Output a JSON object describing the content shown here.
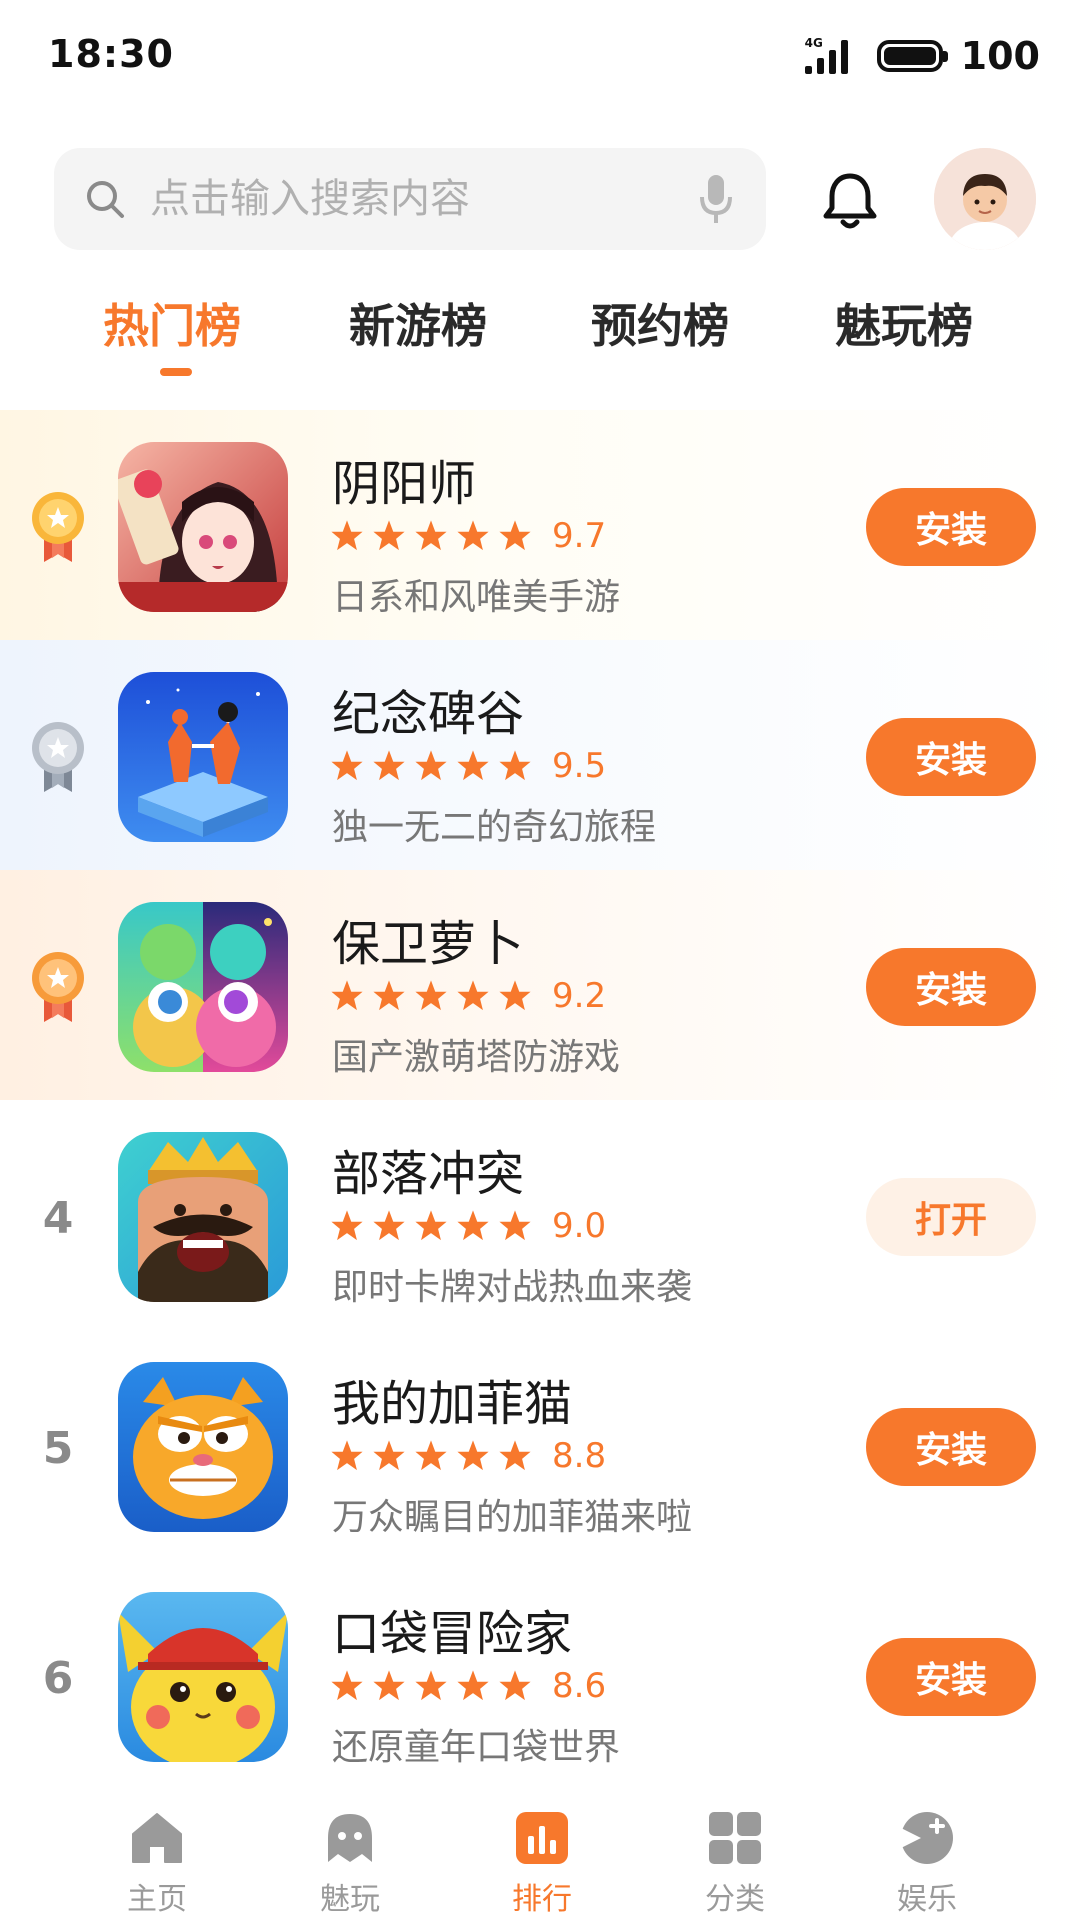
{
  "status_bar": {
    "time": "18:30",
    "network": "4G",
    "battery": "100"
  },
  "search": {
    "placeholder": "点击输入搜索内容"
  },
  "tabs": [
    {
      "label": "热门榜",
      "active": true
    },
    {
      "label": "新游榜",
      "active": false
    },
    {
      "label": "预约榜",
      "active": false
    },
    {
      "label": "魅玩榜",
      "active": false
    }
  ],
  "apps": [
    {
      "rank": "1",
      "title": "阴阳师",
      "rating": "9.7",
      "desc": "日系和风唯美手游",
      "button": "安装"
    },
    {
      "rank": "2",
      "title": "纪念碑谷",
      "rating": "9.5",
      "desc": "独一无二的奇幻旅程",
      "button": "安装"
    },
    {
      "rank": "3",
      "title": "保卫萝卜",
      "rating": "9.2",
      "desc": "国产激萌塔防游戏",
      "button": "安装"
    },
    {
      "rank": "4",
      "title": "部落冲突",
      "rating": "9.0",
      "desc": "即时卡牌对战热血来袭",
      "button": "打开"
    },
    {
      "rank": "5",
      "title": "我的加菲猫",
      "rating": "8.8",
      "desc": "万众瞩目的加菲猫来啦",
      "button": "安装"
    },
    {
      "rank": "6",
      "title": "口袋冒险家",
      "rating": "8.6",
      "desc": "还原童年口袋世界",
      "button": "安装"
    }
  ],
  "bottom_nav": [
    {
      "label": "主页",
      "icon": "home-icon",
      "active": false
    },
    {
      "label": "魅玩",
      "icon": "ghost-icon",
      "active": false
    },
    {
      "label": "排行",
      "icon": "ranking-icon",
      "active": true
    },
    {
      "label": "分类",
      "icon": "grid-icon",
      "active": false
    },
    {
      "label": "娱乐",
      "icon": "play-icon",
      "active": false
    }
  ],
  "colors": {
    "accent": "#f7782c",
    "accent_light": "#fef1e6",
    "muted": "#9a9a9a",
    "gold": "#f5a623",
    "silver": "#b8bfc9"
  }
}
